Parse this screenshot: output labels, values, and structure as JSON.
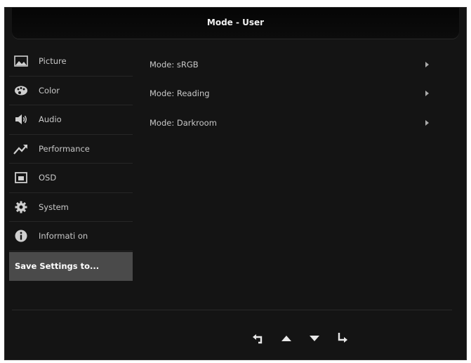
{
  "header": {
    "title": "Mode - User"
  },
  "sidebar": {
    "items": [
      {
        "label": "Picture",
        "icon": "picture-icon"
      },
      {
        "label": "Color",
        "icon": "palette-icon"
      },
      {
        "label": "Audio",
        "icon": "speaker-icon"
      },
      {
        "label": "Performance",
        "icon": "trend-icon"
      },
      {
        "label": "OSD",
        "icon": "osd-window-icon"
      },
      {
        "label": "System",
        "icon": "gear-icon"
      },
      {
        "label": "Informati on",
        "icon": "info-icon"
      }
    ],
    "selected": {
      "label": "Save Settings to..."
    }
  },
  "main": {
    "options": [
      {
        "label": "Mode: sRGB"
      },
      {
        "label": "Mode: Reading"
      },
      {
        "label": "Mode: Darkroom"
      }
    ]
  },
  "nav": {
    "buttons": [
      {
        "icon": "back-icon"
      },
      {
        "icon": "up-arrow-icon"
      },
      {
        "icon": "down-arrow-icon"
      },
      {
        "icon": "enter-icon"
      }
    ]
  },
  "colors": {
    "background": "#141414",
    "selected": "#4a4a4a",
    "text": "#c8c8c8"
  }
}
